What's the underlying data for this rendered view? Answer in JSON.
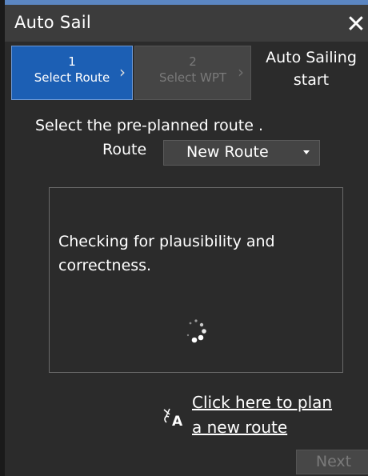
{
  "window": {
    "title": "Auto Sail"
  },
  "steps": [
    {
      "num": "1",
      "label": "Select Route",
      "state": "active"
    },
    {
      "num": "2",
      "label": "Select WPT",
      "state": "disabled"
    },
    {
      "line1": "Auto Sailing",
      "line2": "start",
      "state": "pending"
    }
  ],
  "instruction": "Select the pre-planned route .",
  "route": {
    "label": "Route",
    "selected": "New Route"
  },
  "status": {
    "line1": "Checking for plausibility and",
    "line2": "correctness."
  },
  "plan_link": {
    "line1": "Click here to plan",
    "line2": "a new route"
  },
  "footer": {
    "next_label": "Next"
  },
  "colors": {
    "active_step": "#1c5fb4",
    "background": "#2b2b2b",
    "titlebar": "#3c3c3c"
  }
}
